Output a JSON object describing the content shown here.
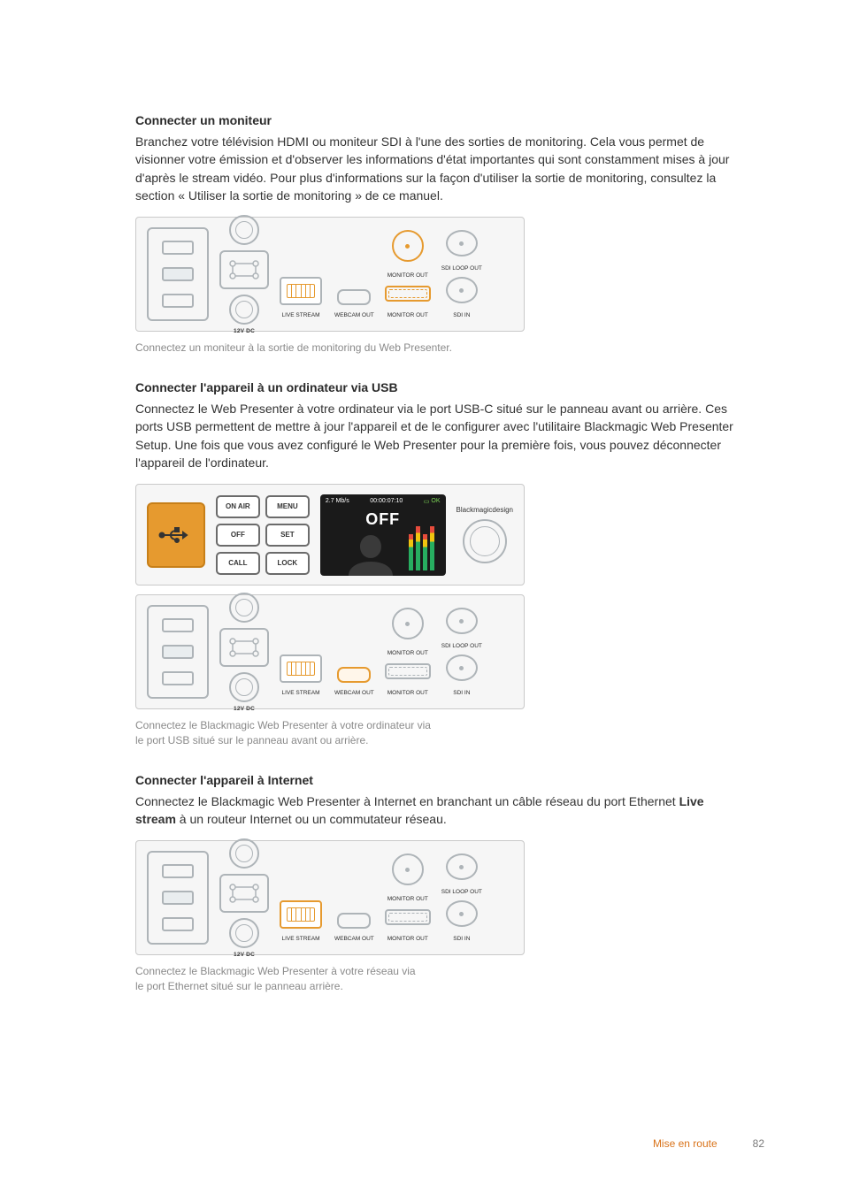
{
  "section1": {
    "heading": "Connecter un moniteur",
    "para": "Branchez votre télévision HDMI ou moniteur SDI à l'une des sorties de monitoring. Cela vous permet de visionner votre émission et d'observer les informations d'état importantes qui sont constamment mises à jour d'après le stream vidéo. Pour plus d'informations sur la façon d'utiliser la sortie de monitoring, consultez la section « Utiliser la sortie de monitoring » de ce manuel.",
    "caption": "Connectez un moniteur à la sortie de monitoring du Web Presenter."
  },
  "section2": {
    "heading": "Connecter l'appareil à un ordinateur via USB",
    "para": "Connectez le Web Presenter à votre ordinateur via le port USB-C situé sur le panneau avant ou arrière. Ces ports USB permettent de mettre à jour l'appareil et de le configurer avec l'utilitaire Blackmagic Web Presenter Setup. Une fois que vous avez configuré le Web Presenter pour la première fois, vous pouvez déconnecter l'appareil de l'ordinateur.",
    "caption1": "Connectez le Blackmagic Web Presenter à votre ordinateur via",
    "caption2": "le port USB situé sur le panneau avant ou arrière."
  },
  "section3": {
    "heading": "Connecter l'appareil à Internet",
    "para_pre": "Connectez le Blackmagic Web Presenter à Internet en branchant un câble réseau du port Ethernet ",
    "para_bold": "Live stream",
    "para_post": " à un routeur Internet ou un commutateur réseau.",
    "caption1": "Connectez le Blackmagic Web Presenter à votre réseau via",
    "caption2": "le port Ethernet situé sur le panneau arrière."
  },
  "backpanel_labels": {
    "dc": "12V DC",
    "live": "LIVE STREAM",
    "webcam": "WEBCAM OUT",
    "mon": "MONITOR OUT",
    "sdiloop": "SDI LOOP OUT",
    "sdiin": "SDI IN"
  },
  "frontpanel": {
    "btn_onair": "ON AIR",
    "btn_menu": "MENU",
    "btn_off": "OFF",
    "btn_set": "SET",
    "btn_call": "CALL",
    "btn_lock": "LOCK",
    "rate": "2.7 Mb/s",
    "tc": "00:00:07:10",
    "ok": "OK",
    "big": "OFF",
    "logo": "Blackmagicdesign"
  },
  "footer": {
    "section": "Mise en route",
    "page": "82"
  }
}
